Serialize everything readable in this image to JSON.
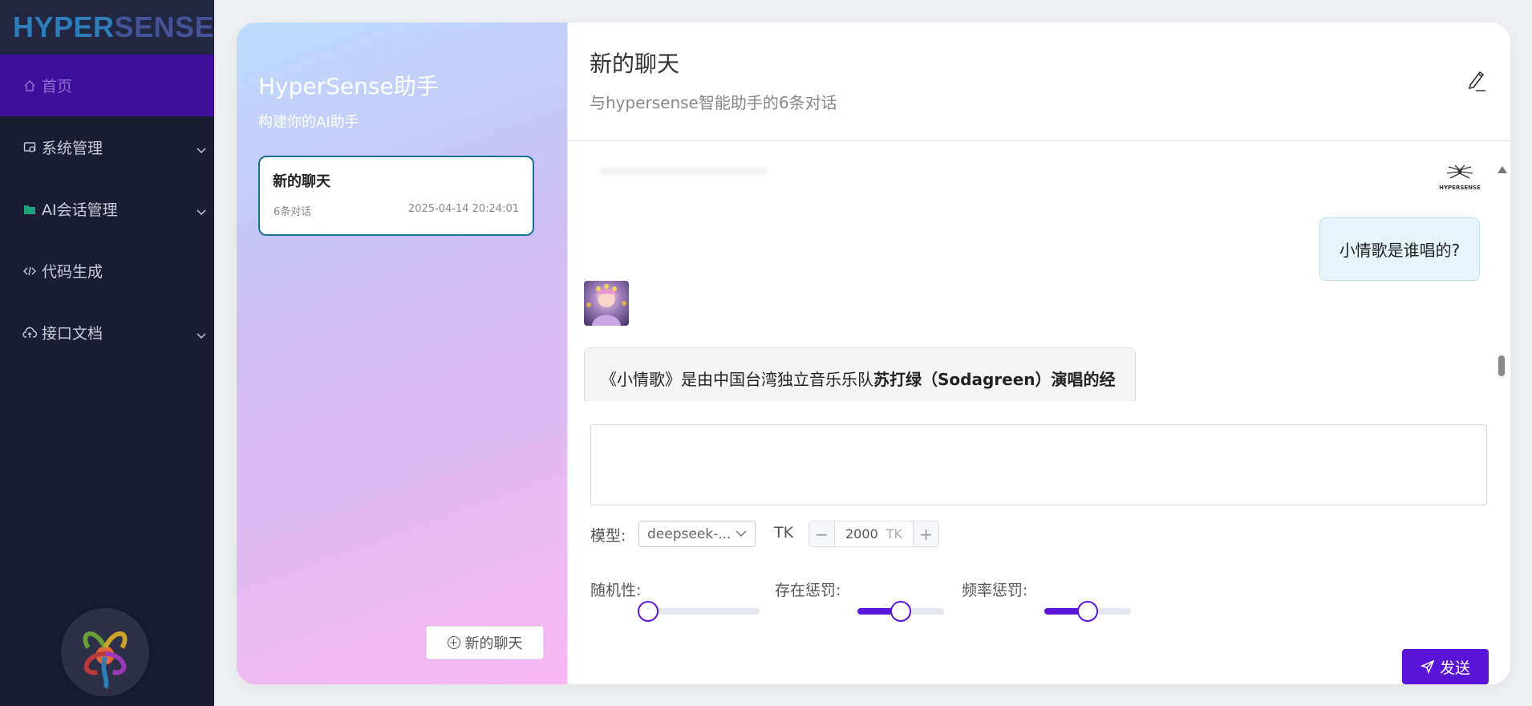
{
  "sidebar": {
    "logo": {
      "text_a": "HYPER",
      "text_b": "SENSE"
    },
    "items": [
      {
        "label": "首页",
        "icon": "home-icon",
        "active": true
      },
      {
        "label": "系统管理",
        "icon": "system-icon",
        "has_children": true
      },
      {
        "label": "AI会话管理",
        "icon": "folder-icon",
        "has_children": true
      },
      {
        "label": "代码生成",
        "icon": "code-icon",
        "has_children": false
      },
      {
        "label": "接口文档",
        "icon": "cloud-icon",
        "has_children": true
      }
    ]
  },
  "conversations": {
    "title": "HyperSense助手",
    "subtitle": "构建你的AI助手",
    "list": [
      {
        "title": "新的聊天",
        "count": "6条对话",
        "time": "2025-04-14 20:24:01"
      }
    ],
    "new_chat_label": "新的聊天"
  },
  "chat": {
    "title": "新的聊天",
    "subtitle": "与hypersense智能助手的6条对话",
    "messages": [
      {
        "role": "user",
        "text": "小情歌是谁唱的?"
      },
      {
        "role": "assistant",
        "text_line1_plain": "《小情歌》是由中国台湾独立音乐乐队",
        "text_line1_bold": "苏打绿（Sodagreen）演唱的经"
      }
    ]
  },
  "composer": {
    "input_value": "",
    "model_label": "模型:",
    "model_value": "deepseek-...",
    "tk_label": "TK",
    "tk_value": "2000",
    "tk_unit": "TK",
    "randomness_label": "随机性:",
    "randomness_value": 0.0,
    "presence_label": "存在惩罚:",
    "presence_value": 0.5,
    "frequency_label": "频率惩罚:",
    "frequency_value": 0.5,
    "send_label": "发送"
  },
  "colors": {
    "accent": "#5a14d8",
    "sidebar_bg": "#1b1d34",
    "active_menu": "#3d0f9a"
  }
}
